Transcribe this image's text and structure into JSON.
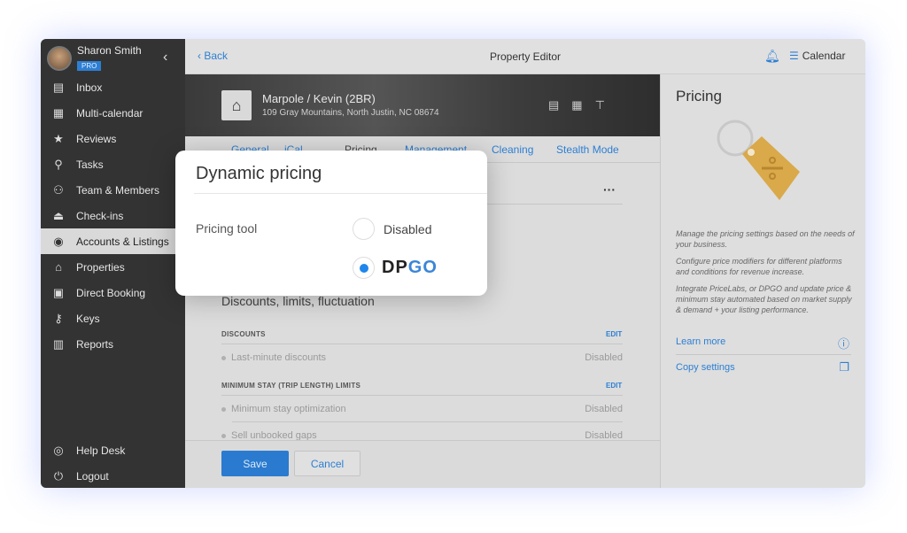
{
  "user": {
    "name": "Sharon Smith",
    "badge": "PRO"
  },
  "sidebar": {
    "items": [
      {
        "label": "Inbox",
        "icon": "chat-icon",
        "glyph": "▤"
      },
      {
        "label": "Multi-calendar",
        "icon": "calendar-icon",
        "glyph": "▦"
      },
      {
        "label": "Reviews",
        "icon": "star-icon",
        "glyph": "★"
      },
      {
        "label": "Tasks",
        "icon": "broom-icon",
        "glyph": "⚲"
      },
      {
        "label": "Team & Members",
        "icon": "team-icon",
        "glyph": "⚇"
      },
      {
        "label": "Check-ins",
        "icon": "bell-desk-icon",
        "glyph": "⏏"
      },
      {
        "label": "Accounts & Listings",
        "icon": "account-icon",
        "glyph": "◉",
        "active": true
      },
      {
        "label": "Properties",
        "icon": "home-icon",
        "glyph": "⌂"
      },
      {
        "label": "Direct Booking",
        "icon": "web-icon",
        "glyph": "▣"
      },
      {
        "label": "Keys",
        "icon": "key-icon",
        "glyph": "⚷"
      },
      {
        "label": "Reports",
        "icon": "chart-icon",
        "glyph": "▥"
      }
    ],
    "bottom": [
      {
        "label": "Help Desk",
        "icon": "lifebuoy-icon",
        "glyph": "◎"
      },
      {
        "label": "Logout",
        "icon": "power-icon",
        "glyph": "⏻"
      }
    ]
  },
  "header": {
    "back": "Back",
    "title": "Property Editor",
    "calendar": "Calendar"
  },
  "property": {
    "name": "Marpole / Kevin (2BR)",
    "address": "109 Gray Mountains, North Justin, NC 08674"
  },
  "tabs": [
    "General",
    "iCal",
    "Pricing",
    "Management",
    "Cleaning",
    "Stealth Mode"
  ],
  "active_tab": "Pricing",
  "content": {
    "section_title": "Discounts, limits, fluctuation",
    "discounts": {
      "label": "DISCOUNTS",
      "edit": "EDIT",
      "rows": [
        {
          "name": "Last-minute discounts",
          "value": "Disabled"
        }
      ]
    },
    "min_stay": {
      "label": "MINIMUM STAY (TRIP LENGTH) LIMITS",
      "edit": "EDIT",
      "rows": [
        {
          "name": "Minimum stay optimization",
          "value": "Disabled"
        },
        {
          "name": "Sell unbooked gaps",
          "value": "Disabled"
        }
      ]
    }
  },
  "footer": {
    "save": "Save",
    "cancel": "Cancel"
  },
  "right_panel": {
    "title": "Pricing",
    "paragraphs": [
      "Manage the pricing settings based on the needs of your business.",
      "Configure price modifiers for different platforms and conditions for revenue increase.",
      "Integrate PriceLabs, or DPGO and update price & minimum stay automated based on market supply & demand + your listing performance."
    ],
    "learn_more": "Learn more",
    "copy_settings": "Copy settings"
  },
  "modal": {
    "title": "Dynamic pricing",
    "field_label": "Pricing tool",
    "options": [
      {
        "label": "Disabled",
        "selected": false
      },
      {
        "label": "DPGO",
        "selected": true
      }
    ],
    "logo_a": "DP",
    "logo_b": "GO"
  },
  "colors": {
    "accent": "#2d7fd3",
    "sidebar": "#333333",
    "radio_selected": "#1f86ec"
  }
}
